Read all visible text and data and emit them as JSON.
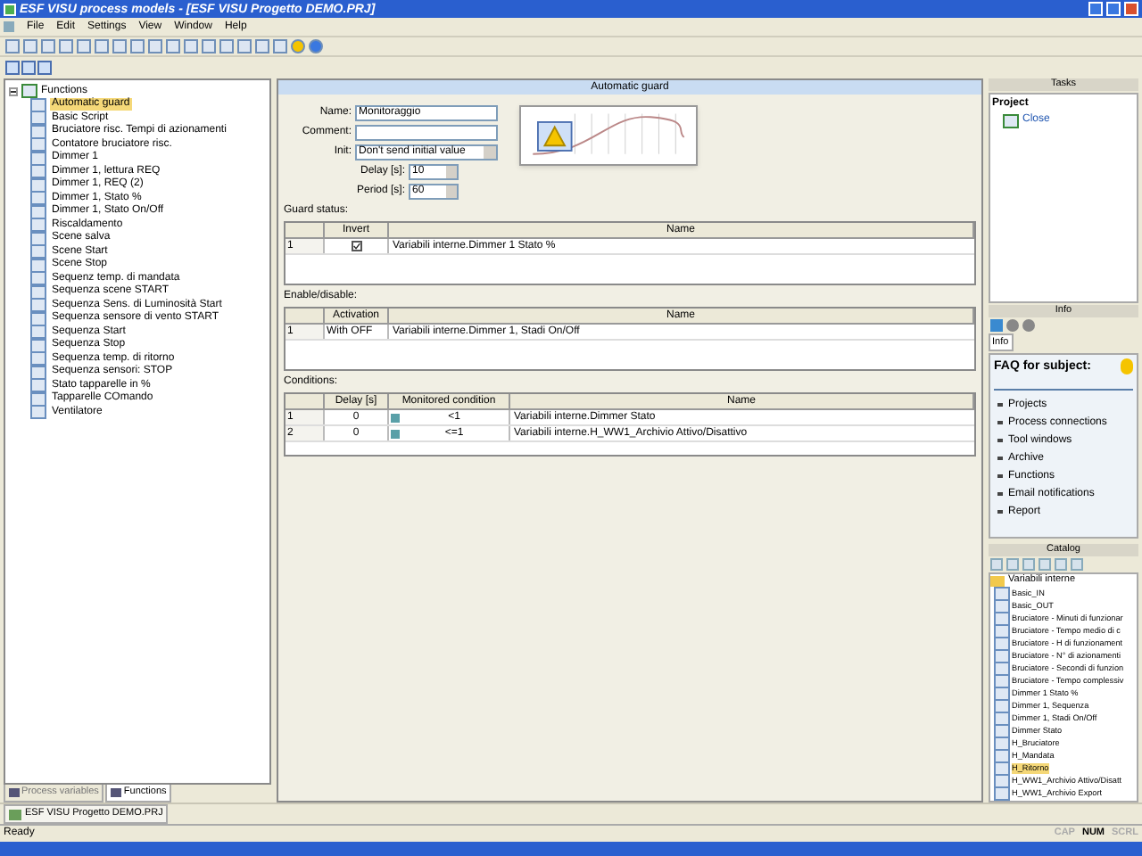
{
  "window": {
    "title": "ESF VISU process models - [ESF VISU Progetto DEMO.PRJ]"
  },
  "menu": [
    "File",
    "Edit",
    "Settings",
    "View",
    "Window",
    "Help"
  ],
  "tree": {
    "label": "Functions",
    "expanded": true,
    "children": [
      {
        "label": "Automatic guard",
        "selected": true
      },
      {
        "label": "Basic Script",
        "selected": false
      },
      {
        "label": "Bruciatore risc. Tempi di azionamenti",
        "selected": false
      },
      {
        "label": "Contatore bruciatore risc.",
        "selected": false
      },
      {
        "label": "Dimmer 1",
        "selected": false
      },
      {
        "label": "Dimmer 1, lettura REQ",
        "selected": false
      },
      {
        "label": "Dimmer 1, REQ (2)",
        "selected": false
      },
      {
        "label": "Dimmer 1, Stato %",
        "selected": false
      },
      {
        "label": "Dimmer 1, Stato On/Off",
        "selected": false
      },
      {
        "label": "Riscaldamento",
        "selected": false
      },
      {
        "label": "Scene salva",
        "selected": false
      },
      {
        "label": "Scene Start",
        "selected": false
      },
      {
        "label": "Scene Stop",
        "selected": false
      },
      {
        "label": "Sequenz temp. di mandata",
        "selected": false
      },
      {
        "label": "Sequenza scene START",
        "selected": false
      },
      {
        "label": "Sequenza Sens. di Luminosità Start",
        "selected": false
      },
      {
        "label": "Sequenza sensore di vento START",
        "selected": false
      },
      {
        "label": "Sequenza Start",
        "selected": false
      },
      {
        "label": "Sequenza Stop",
        "selected": false
      },
      {
        "label": "Sequenza temp. di ritorno",
        "selected": false
      },
      {
        "label": "Sequenza sensori: STOP",
        "selected": false
      },
      {
        "label": "Stato tapparelle in %",
        "selected": false
      },
      {
        "label": "Tapparelle COmando",
        "selected": false
      },
      {
        "label": "Ventilatore",
        "selected": false
      }
    ]
  },
  "left_tabs": [
    {
      "label": "Process variables",
      "selected": false
    },
    {
      "label": "Functions",
      "selected": true
    }
  ],
  "editor": {
    "title": "Automatic guard",
    "fields": [
      {
        "label": "Name:",
        "value": "Monitoraggio"
      },
      {
        "label": "Comment:"
      }
    ],
    "init": {
      "label": "Init:",
      "value": "Don't send initial value"
    },
    "spinners": [
      {
        "label": "Delay [s]:",
        "value": "10"
      },
      {
        "label": "Period [s]:",
        "value": "60"
      }
    ],
    "guard_status": {
      "title": "Guard status:",
      "columns": [
        "Invert",
        "Name"
      ],
      "rows": [
        {
          "index": "1",
          "checked": true,
          "name": "Variabili interne.Dimmer 1 Stato %"
        }
      ]
    },
    "enable_disable": {
      "title": "Enable/disable:",
      "columns": [
        "Activation",
        "Name"
      ],
      "rows": [
        {
          "index": "1",
          "activation": "With OFF",
          "name": "Variabili interne.Dimmer 1, Stadi On/Off"
        }
      ]
    },
    "conditions": {
      "title": "Conditions:",
      "columns": [
        "Delay [s]",
        "Monitored condition",
        "Name"
      ],
      "rows": [
        {
          "index": "1",
          "delay": "0",
          "condition": "<1",
          "name": "Variabili interne.Dimmer Stato"
        },
        {
          "index": "2",
          "delay": "0",
          "condition": "<=1",
          "name": "Variabili interne.H_WW1_Archivio Attivo/Disattivo"
        }
      ]
    }
  },
  "tasks": {
    "title": "Tasks",
    "section": "Project",
    "items": [
      "Close"
    ]
  },
  "info": {
    "title": "Info",
    "tab": "Info",
    "heading": "FAQ for subject:",
    "items": [
      "Projects",
      "Process connections",
      "Tool windows",
      "Archive",
      "Functions",
      "Email notifications",
      "Report"
    ]
  },
  "catalog": {
    "title": "Catalog",
    "folder": "Variabili interne",
    "items": [
      {
        "label": "Basic_IN",
        "selected": false
      },
      {
        "label": "Basic_OUT",
        "selected": false
      },
      {
        "label": "Bruciatore - Minuti di funzionar",
        "selected": false
      },
      {
        "label": "Bruciatore - Tempo medio di c",
        "selected": false
      },
      {
        "label": "Bruciatore - H di funzionament",
        "selected": false
      },
      {
        "label": "Bruciatore - N° di azionamenti",
        "selected": false
      },
      {
        "label": "Bruciatore - Secondi di funzion",
        "selected": false
      },
      {
        "label": "Bruciatore - Tempo complessiv",
        "selected": false
      },
      {
        "label": "Dimmer 1 Stato %",
        "selected": false
      },
      {
        "label": "Dimmer 1, Sequenza",
        "selected": false
      },
      {
        "label": "Dimmer 1, Stadi On/Off",
        "selected": false
      },
      {
        "label": "Dimmer Stato",
        "selected": false
      },
      {
        "label": "H_Bruciatore",
        "selected": false
      },
      {
        "label": "H_Mandata",
        "selected": false
      },
      {
        "label": "H_Ritorno",
        "selected": true
      },
      {
        "label": "H_WW1_Archivio Attivo/Disatt",
        "selected": false
      },
      {
        "label": "H_WW1_Archivio Export",
        "selected": false
      }
    ]
  },
  "document_tab": "ESF VISU Progetto DEMO.PRJ",
  "status_bar": {
    "text": "Ready",
    "indicators": [
      {
        "label": "CAP",
        "on": false
      },
      {
        "label": "NUM",
        "on": true
      },
      {
        "label": "SCRL",
        "on": false
      }
    ]
  }
}
